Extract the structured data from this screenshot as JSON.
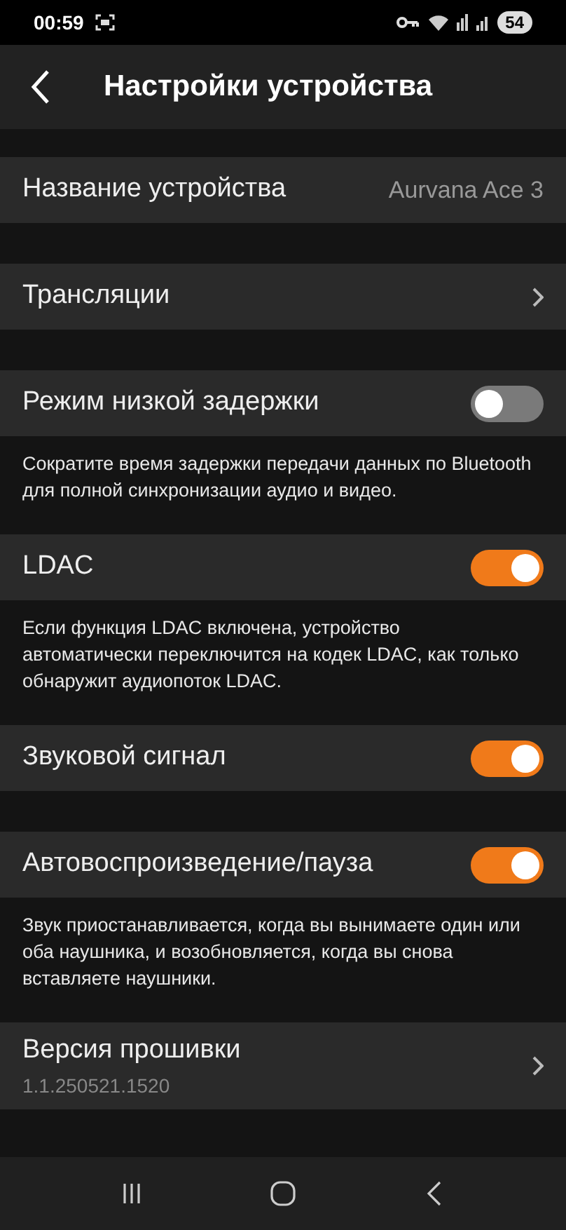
{
  "status_bar": {
    "time": "00:59",
    "battery": "54"
  },
  "header": {
    "title": "Настройки устройства"
  },
  "rows": [
    {
      "kind": "value",
      "label": "Название устройства",
      "value": "Aurvana Ace 3"
    },
    {
      "kind": "link",
      "label": "Трансляции"
    },
    {
      "kind": "toggle",
      "label": "Режим низкой задержки",
      "on": false,
      "description": "Сократите время задержки передачи данных по Bluetooth для полной синхронизации аудио и видео."
    },
    {
      "kind": "toggle",
      "label": "LDAC",
      "on": true,
      "description": "Если функция LDAC включена, устройство автоматически переключится на кодек LDAC, как только обнаружит аудиопоток LDAC."
    },
    {
      "kind": "toggle",
      "label": "Звуковой сигнал",
      "on": true
    },
    {
      "kind": "toggle",
      "label": "Автовоспроизведение/пауза",
      "on": true,
      "description": "Звук приостанавливается, когда вы вынимаете один или оба наушника, и возобновляется, когда вы снова вставляете наушники."
    },
    {
      "kind": "link",
      "label": "Версия прошивки",
      "subtitle": "1.1.250521.1520"
    }
  ]
}
